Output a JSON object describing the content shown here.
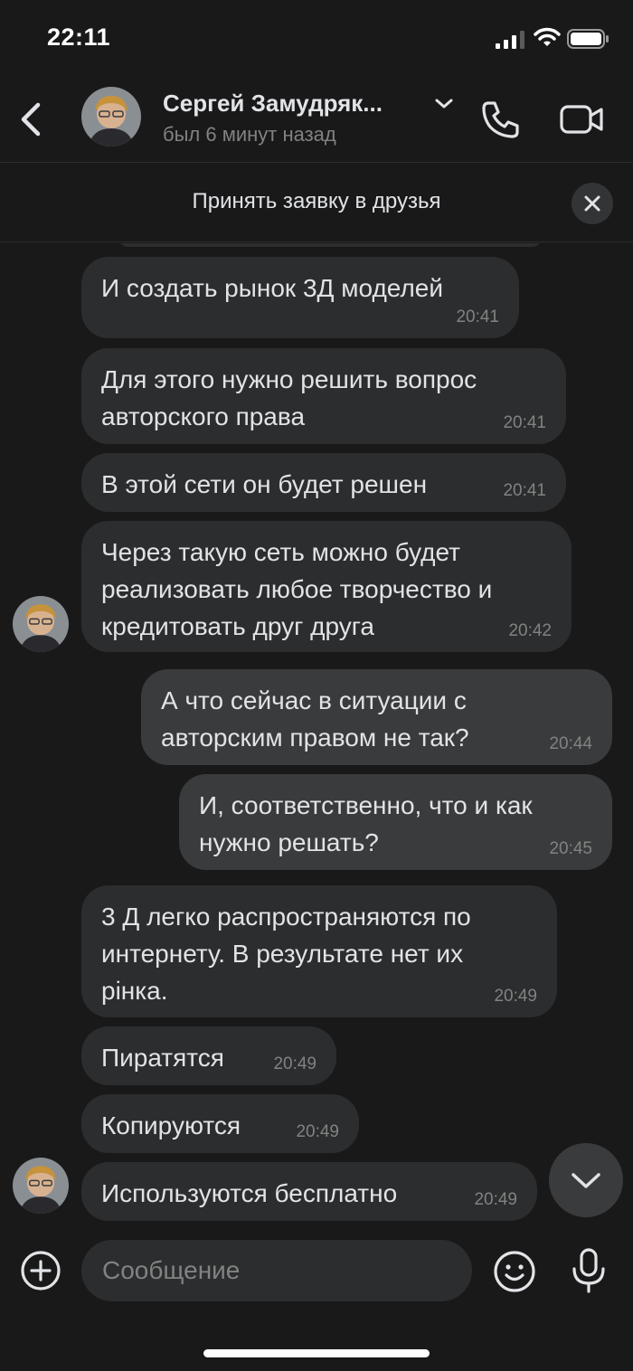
{
  "status_bar": {
    "time": "22:11"
  },
  "header": {
    "contact_name": "Сергей Замудряк...",
    "contact_status": "был 6 минут назад"
  },
  "friend_request": {
    "label": "Принять заявку в друзья"
  },
  "messages": [
    {
      "direction": "in",
      "text": "И создать рынок 3Д моделей",
      "time": "20:41"
    },
    {
      "direction": "in",
      "text": "Для этого нужно решить вопрос\nавторского права",
      "time": "20:41"
    },
    {
      "direction": "in",
      "text": "В этой сети он будет решен",
      "time": "20:41"
    },
    {
      "direction": "in",
      "text": "Через такую сеть можно будет\nреализовать любое творчество и\nкредитовать друг друга",
      "time": "20:42"
    },
    {
      "direction": "out",
      "text": "А что сейчас в ситуации с\nавторским правом не так?",
      "time": "20:44"
    },
    {
      "direction": "out",
      "text": "И, соответственно, что и как\nнужно решать?",
      "time": "20:45"
    },
    {
      "direction": "in",
      "text": "3 Д легко распространяются по\nинтернету. В результате нет их\nрінка.",
      "time": "20:49"
    },
    {
      "direction": "in",
      "text": "Пиратятся",
      "time": "20:49"
    },
    {
      "direction": "in",
      "text": "Копируются",
      "time": "20:49"
    },
    {
      "direction": "in",
      "text": "Используются бесплатно",
      "time": "20:49"
    }
  ],
  "composer": {
    "placeholder": "Сообщение"
  },
  "icons": {
    "back": "chevron-left-icon",
    "name_dropdown": "chevron-down-icon",
    "call": "phone-icon",
    "video": "video-camera-icon",
    "close": "close-icon",
    "scroll_down": "chevron-down-icon",
    "attach": "plus-circle-icon",
    "emoji": "smile-icon",
    "mic": "microphone-icon"
  },
  "colors": {
    "background": "#19191a",
    "incoming_bubble": "#2c2d2e",
    "outgoing_bubble": "#3a3b3c",
    "text_primary": "#e1e3e6",
    "text_secondary": "#828282"
  }
}
